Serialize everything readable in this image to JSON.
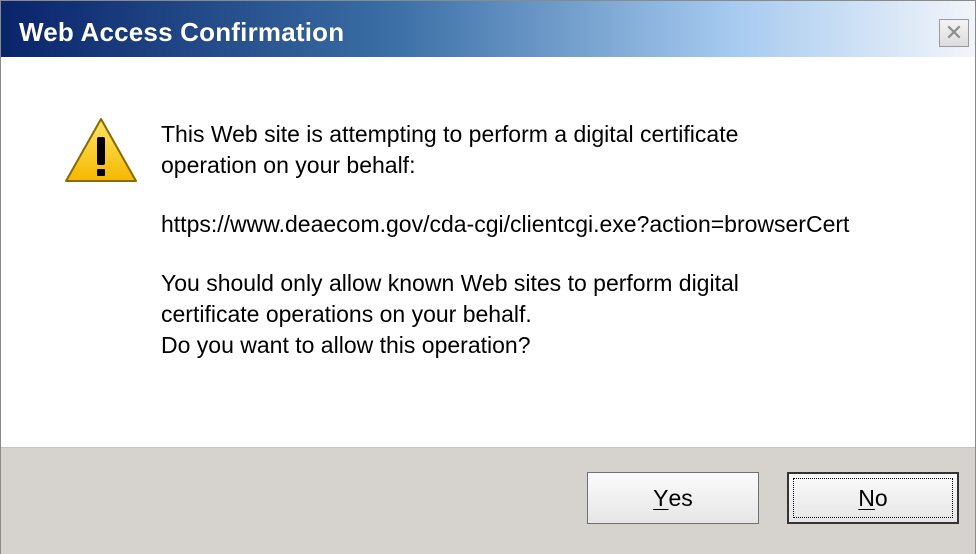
{
  "window": {
    "title": "Web Access Confirmation",
    "close_glyph": "✕"
  },
  "dialog": {
    "icon": "warning-triangle-icon",
    "message_line1": "This Web site is attempting to perform a digital certificate\noperation on your behalf:",
    "url": "https://www.deaecom.gov/cda-cgi/clientcgi.exe?action=browserCert",
    "advice": "You should only allow known Web sites to perform digital\ncertificate operations on your behalf.\nDo you want to allow this operation?"
  },
  "buttons": {
    "yes_mnemonic": "Y",
    "yes_rest": "es",
    "no_mnemonic": "N",
    "no_rest": "o"
  },
  "colors": {
    "title_gradient_start": "#0a246a",
    "button_bar": "#d6d3ce",
    "warning_yellow": "#f5c400"
  }
}
